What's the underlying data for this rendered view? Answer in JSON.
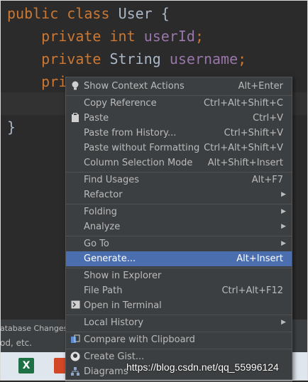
{
  "code": {
    "line1": {
      "kw1": "public",
      "kw2": "class",
      "name": "User",
      "brace": "{"
    },
    "line2": {
      "kw": "private",
      "type": "int",
      "field": "userId",
      "semi": ";"
    },
    "line3": {
      "kw": "private",
      "type": "String",
      "field": "username",
      "semi": ";"
    },
    "line4": {
      "kw": "pri"
    },
    "line6": {
      "brace": "}"
    }
  },
  "bottom": {
    "db_tab": "atabase Changes",
    "etc": "od, etc."
  },
  "menu": {
    "items": [
      {
        "label": "Show Context Actions",
        "shortcut": "Alt+Enter",
        "icon": "lightbulb-icon"
      },
      {
        "label": "Copy Reference",
        "shortcut": "Ctrl+Alt+Shift+C"
      },
      {
        "label": "Paste",
        "shortcut": "Ctrl+V",
        "icon": "clipboard-icon"
      },
      {
        "label": "Paste from History...",
        "shortcut": "Ctrl+Shift+V"
      },
      {
        "label": "Paste without Formatting",
        "shortcut": "Ctrl+Alt+Shift+V"
      },
      {
        "label": "Column Selection Mode",
        "shortcut": "Alt+Shift+Insert"
      },
      {
        "label": "Find Usages",
        "shortcut": "Alt+F7"
      },
      {
        "label": "Refactor",
        "shortcut": ""
      },
      {
        "label": "Folding",
        "shortcut": ""
      },
      {
        "label": "Analyze",
        "shortcut": ""
      },
      {
        "label": "Go To",
        "shortcut": ""
      },
      {
        "label": "Generate...",
        "shortcut": "Alt+Insert"
      },
      {
        "label": "Show in Explorer",
        "shortcut": ""
      },
      {
        "label": "File Path",
        "shortcut": "Ctrl+Alt+F12"
      },
      {
        "label": "Open in Terminal",
        "shortcut": "",
        "icon": "terminal-icon"
      },
      {
        "label": "Local History",
        "shortcut": ""
      },
      {
        "label": "Compare with Clipboard",
        "shortcut": "",
        "icon": "compare-icon"
      },
      {
        "label": "Create Gist...",
        "shortcut": "",
        "icon": "github-icon"
      },
      {
        "label": "Diagrams",
        "shortcut": "",
        "icon": "diagram-icon"
      }
    ]
  },
  "watermark": "https://blog.csdn.net/qq_55996124"
}
